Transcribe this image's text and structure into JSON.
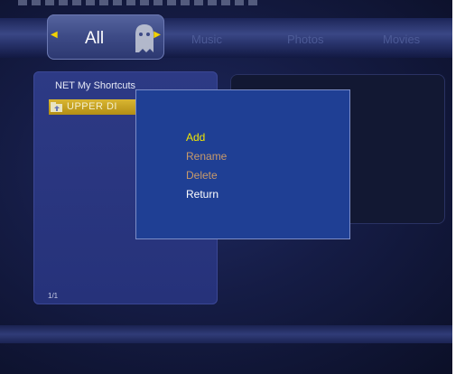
{
  "colors": {
    "accent_yellow": "#f2d200",
    "menu_active": "#f2e600",
    "menu_disabled": "#c89a6a",
    "menu_normal": "#ffffff",
    "popup_bg": "#1f3f94"
  },
  "header": {
    "selected_tab": "All",
    "tabs": [
      "Music",
      "Photos",
      "Movies"
    ],
    "selected_icon": "ghost-icon"
  },
  "browser": {
    "title": "NET  My Shortcuts",
    "selected_item": "UPPER DI",
    "selected_item_icon": "folder-up-icon",
    "page_indicator": "1/1"
  },
  "context_menu": {
    "items": [
      {
        "label": "Add",
        "state": "active"
      },
      {
        "label": "Rename",
        "state": "disabled"
      },
      {
        "label": "Delete",
        "state": "disabled"
      },
      {
        "label": "Return",
        "state": "normal"
      }
    ]
  }
}
